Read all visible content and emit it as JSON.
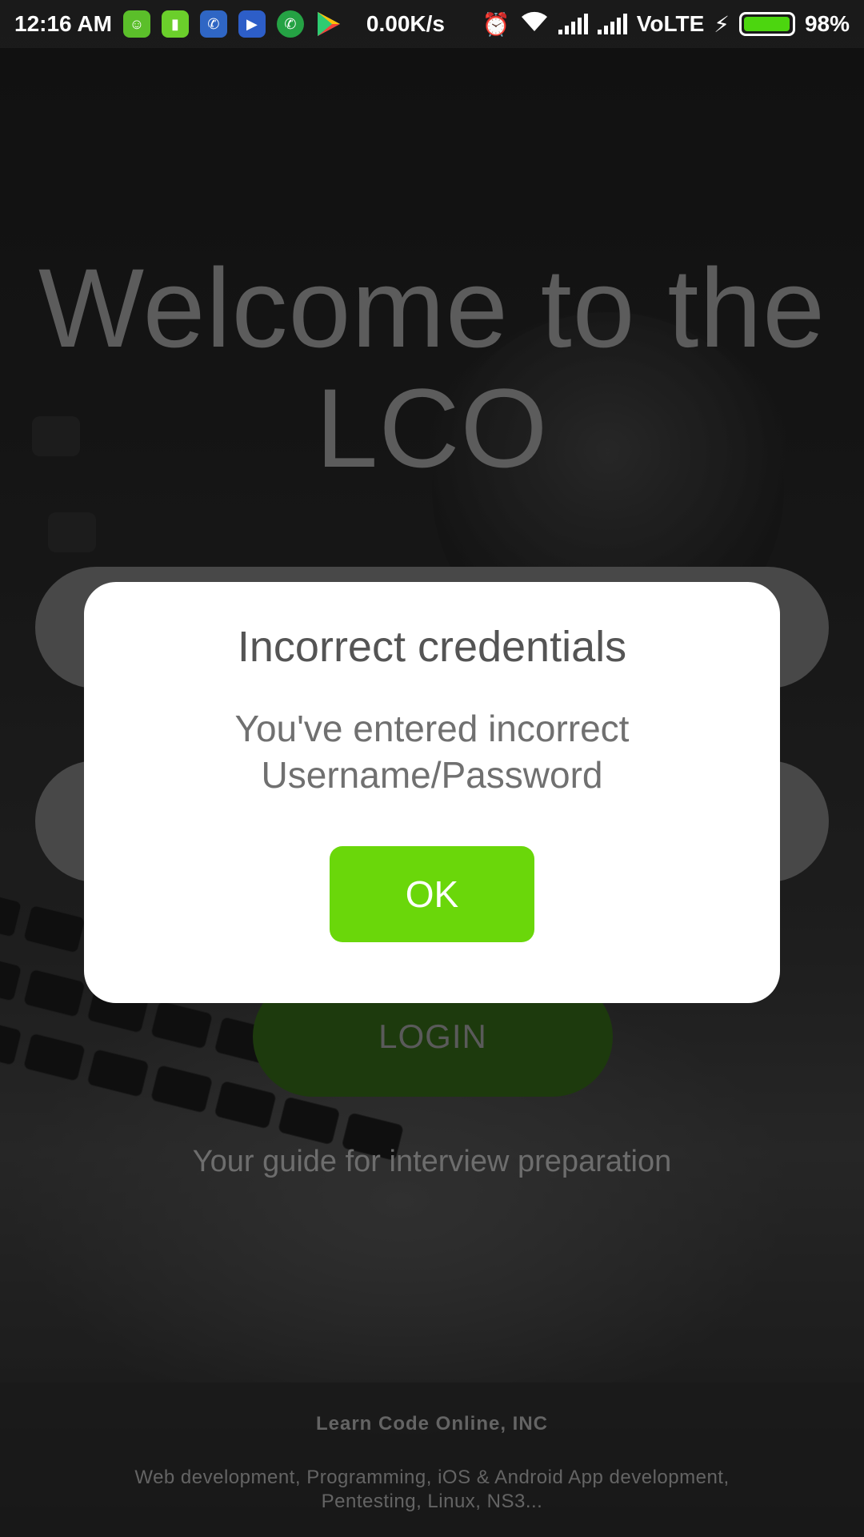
{
  "status_bar": {
    "time": "12:16 AM",
    "network_speed": "0.00K/s",
    "network_type": "VoLTE",
    "battery_percent": "98%",
    "battery_level": 0.98,
    "app_icons": [
      "android-icon",
      "battery-saver-icon",
      "phone-icon",
      "video-call-icon",
      "whatsapp-icon",
      "play-store-icon"
    ],
    "accent_battery": "#4cd60f"
  },
  "hero": {
    "line1": "Welcome to the",
    "line2": "LCO"
  },
  "login": {
    "button_label": "LOGIN",
    "tagline": "Your guide for interview preparation"
  },
  "footer": {
    "company": "Learn Code Online, INC",
    "description": "Web development, Programming, iOS & Android App development, Pentesting, Linux, NS3..."
  },
  "dialog": {
    "title": "Incorrect credentials",
    "message": "You've entered incorrect Username/Password",
    "ok_label": "OK",
    "ok_color": "#6ad70a"
  }
}
